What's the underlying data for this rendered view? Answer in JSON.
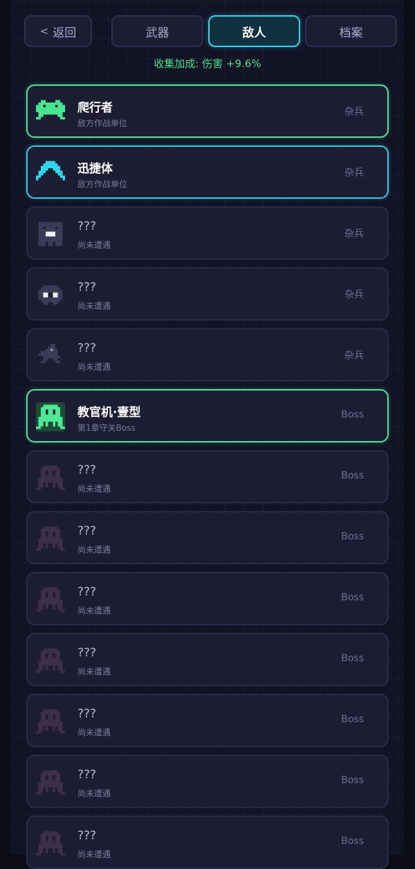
{
  "header": {
    "back_label": "返回",
    "tabs": [
      {
        "label": "武器",
        "active": false
      },
      {
        "label": "敌人",
        "active": true
      },
      {
        "label": "档案",
        "active": false
      }
    ]
  },
  "bonus_text": "收集加成: 伤害 +9.6%",
  "colors": {
    "accent_cyan": "#30d6ee",
    "accent_green": "#52e39a",
    "card_bg": "#1c1d33",
    "page_bg": "#121324"
  },
  "entries": [
    {
      "name": "爬行者",
      "subtitle": "敌方作战单位",
      "tier": "杂兵",
      "icon": "green-invader-icon"
    },
    {
      "name": "迅捷体",
      "subtitle": "敌方作战单位",
      "tier": "杂兵",
      "icon": "cyan-chevron-icon"
    },
    {
      "name": "???",
      "subtitle": "尚未遭遇",
      "tier": "杂兵",
      "icon": "locked-block-enemy-icon"
    },
    {
      "name": "???",
      "subtitle": "尚未遭遇",
      "tier": "杂兵",
      "icon": "locked-eye-enemy-icon"
    },
    {
      "name": "???",
      "subtitle": "尚未遭遇",
      "tier": "杂兵",
      "icon": "locked-bird-enemy-icon"
    },
    {
      "name": "教官机·壹型",
      "subtitle": "第1章守关Boss",
      "tier": "Boss",
      "icon": "green-boss-icon"
    },
    {
      "name": "???",
      "subtitle": "尚未遭遇",
      "tier": "Boss",
      "icon": "locked-boss-icon"
    },
    {
      "name": "???",
      "subtitle": "尚未遭遇",
      "tier": "Boss",
      "icon": "locked-boss-icon"
    },
    {
      "name": "???",
      "subtitle": "尚未遭遇",
      "tier": "Boss",
      "icon": "locked-boss-icon"
    },
    {
      "name": "???",
      "subtitle": "尚未遭遇",
      "tier": "Boss",
      "icon": "locked-boss-icon"
    },
    {
      "name": "???",
      "subtitle": "尚未遭遇",
      "tier": "Boss",
      "icon": "locked-boss-icon"
    },
    {
      "name": "???",
      "subtitle": "尚未遭遇",
      "tier": "Boss",
      "icon": "locked-boss-icon"
    },
    {
      "name": "???",
      "subtitle": "尚未遭遇",
      "tier": "Boss",
      "icon": "locked-boss-icon"
    }
  ]
}
